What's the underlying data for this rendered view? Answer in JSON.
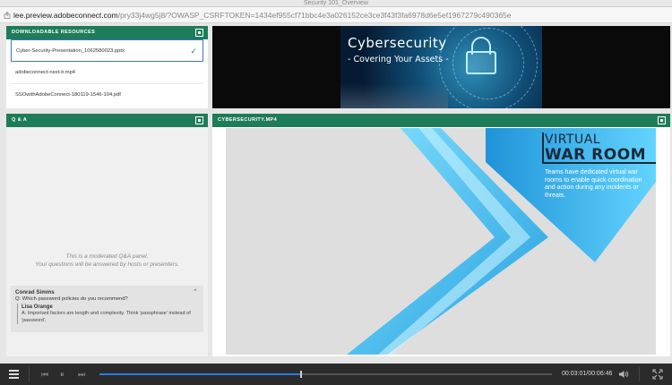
{
  "window": {
    "title": "Security 101_Overview",
    "url_host": "lee.preview.adobeconnect.com",
    "url_rest": "/pry33j4wg5j8/?OWASP_CSRFTOKEN=1434ef955cf71bbc4e3a026152ce3ce3f43f3fa6978d6e5ef1967279c490365e"
  },
  "resources": {
    "header": "DOWNLOADABLE RESOURCES",
    "items": [
      {
        "label": "Cyber-Security-Presentation_1062580023.pptx",
        "selected": true
      },
      {
        "label": "adobeconnect-next-lr.mp4",
        "selected": false
      },
      {
        "label": "SSOwithAdobeConnect-180119-1546-104.pdf",
        "selected": false
      }
    ]
  },
  "qa": {
    "header": "Q & A",
    "note_line1": "This is a moderated Q&A panel.",
    "note_line2": "Your questions will be answered by hosts or presenters.",
    "asker": "Conrad Simms",
    "question": "Q: Which password policies do you recommend?",
    "answerer": "Lisa Orange",
    "answer": "A: Important factors are length and complexity. Think 'passphrase' instead of 'password'."
  },
  "banner": {
    "title": "Cybersecurity",
    "subtitle": "- Covering Your Assets -"
  },
  "video": {
    "header": "CYBERSECURITY.MP4",
    "title_line1": "VIRTUAL",
    "title_line2": "WAR ROOM",
    "body": "Teams have dedicated virtual war rooms to enable quick coordination and action during any incidents or threats."
  },
  "player": {
    "time": "00:03:01/00:06:46",
    "progress_fraction": 0.4448,
    "accent_color": "#2b7be0"
  },
  "colors": {
    "panel_header": "#1f7c58",
    "control_bar": "#2b2b2b"
  }
}
